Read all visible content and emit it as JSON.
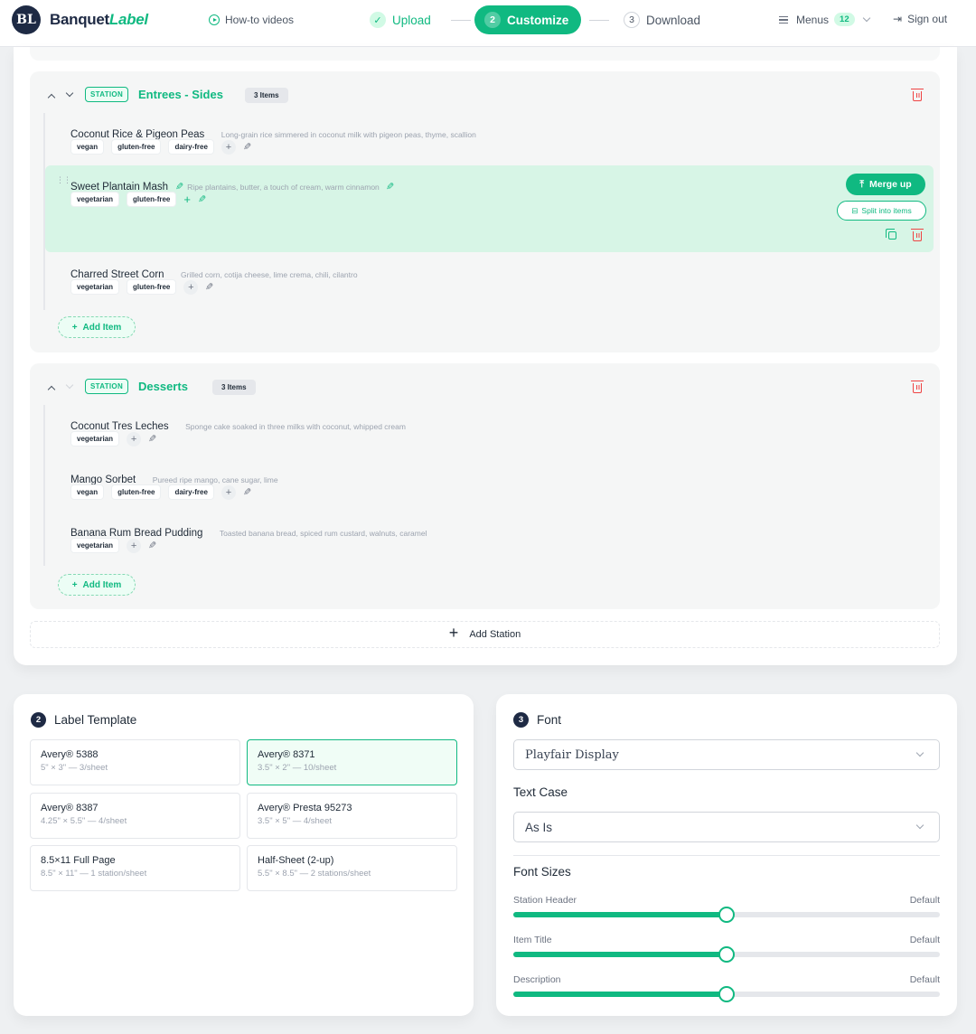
{
  "app": {
    "logo_initials": "BL",
    "brand_primary": "Banquet",
    "brand_accent": "Label"
  },
  "header": {
    "howto_label": "How-to videos",
    "steps": [
      {
        "num": "✓",
        "label": "Upload",
        "state": "done"
      },
      {
        "num": "2",
        "label": "Customize",
        "state": "active"
      },
      {
        "num": "3",
        "label": "Download",
        "state": "pending"
      }
    ],
    "menus_label": "Menus",
    "menus_count": "12",
    "signout_label": "Sign out"
  },
  "stations": [
    {
      "badge": "STATION",
      "name": "Entrees - Sides",
      "count_label": "3 Items",
      "items": [
        {
          "title": "Coconut Rice & Pigeon Peas",
          "description": "Long-grain rice simmered in coconut milk with pigeon peas, thyme, scallion",
          "tags": [
            "vegan",
            "gluten-free",
            "dairy-free"
          ]
        },
        {
          "title": "Sweet Plantain Mash",
          "description": "Ripe plantains, butter, a touch of cream, warm cinnamon",
          "tags": [
            "vegetarian",
            "gluten-free"
          ],
          "selected": true
        },
        {
          "title": "Charred Street Corn",
          "description": "Grilled corn, cotija cheese, lime crema, chili, cilantro",
          "tags": [
            "vegetarian",
            "gluten-free"
          ]
        }
      ],
      "add_item_label": "Add Item"
    },
    {
      "badge": "STATION",
      "name": "Desserts",
      "count_label": "3 Items",
      "items": [
        {
          "title": "Coconut Tres Leches",
          "description": "Sponge cake soaked in three milks with coconut, whipped cream",
          "tags": [
            "vegetarian"
          ]
        },
        {
          "title": "Mango Sorbet",
          "description": "Pureed ripe mango, cane sugar, lime",
          "tags": [
            "vegan",
            "gluten-free",
            "dairy-free"
          ]
        },
        {
          "title": "Banana Rum Bread Pudding",
          "description": "Toasted banana bread, spiced rum custard, walnuts, caramel",
          "tags": [
            "vegetarian"
          ]
        }
      ],
      "add_item_label": "Add Item"
    }
  ],
  "item_actions": {
    "merge_up": "Merge up",
    "split": "Split into items"
  },
  "add_station_label": "Add Station",
  "label_template": {
    "step": "2",
    "title": "Label Template",
    "options": [
      {
        "name": "Avery® 5388",
        "sub": "5\" × 3\" — 3/sheet"
      },
      {
        "name": "Avery® 8371",
        "sub": "3.5\" × 2\" — 10/sheet",
        "selected": true
      },
      {
        "name": "Avery® 8387",
        "sub": "4.25\" × 5.5\" — 4/sheet"
      },
      {
        "name": "Avery® Presta 95273",
        "sub": "3.5\" × 5\" — 4/sheet"
      },
      {
        "name": "8.5×11 Full Page",
        "sub": "8.5\" × 11\" — 1 station/sheet"
      },
      {
        "name": "Half-Sheet (2-up)",
        "sub": "5.5\" × 8.5\" — 2 stations/sheet"
      }
    ]
  },
  "font": {
    "step": "3",
    "title": "Font",
    "font_value": "Playfair Display",
    "text_case_label": "Text Case",
    "text_case_value": "As Is",
    "font_sizes_label": "Font Sizes",
    "sliders": [
      {
        "label": "Station Header",
        "value_label": "Default",
        "level": 0.5
      },
      {
        "label": "Item Title",
        "value_label": "Default",
        "level": 0.5
      },
      {
        "label": "Description",
        "value_label": "Default",
        "level": 0.5
      }
    ]
  },
  "colors": {
    "accent": "#10b981",
    "brand_dark": "#1e2a44",
    "danger": "#ef4444",
    "selected_row": "#d7f5e6"
  }
}
